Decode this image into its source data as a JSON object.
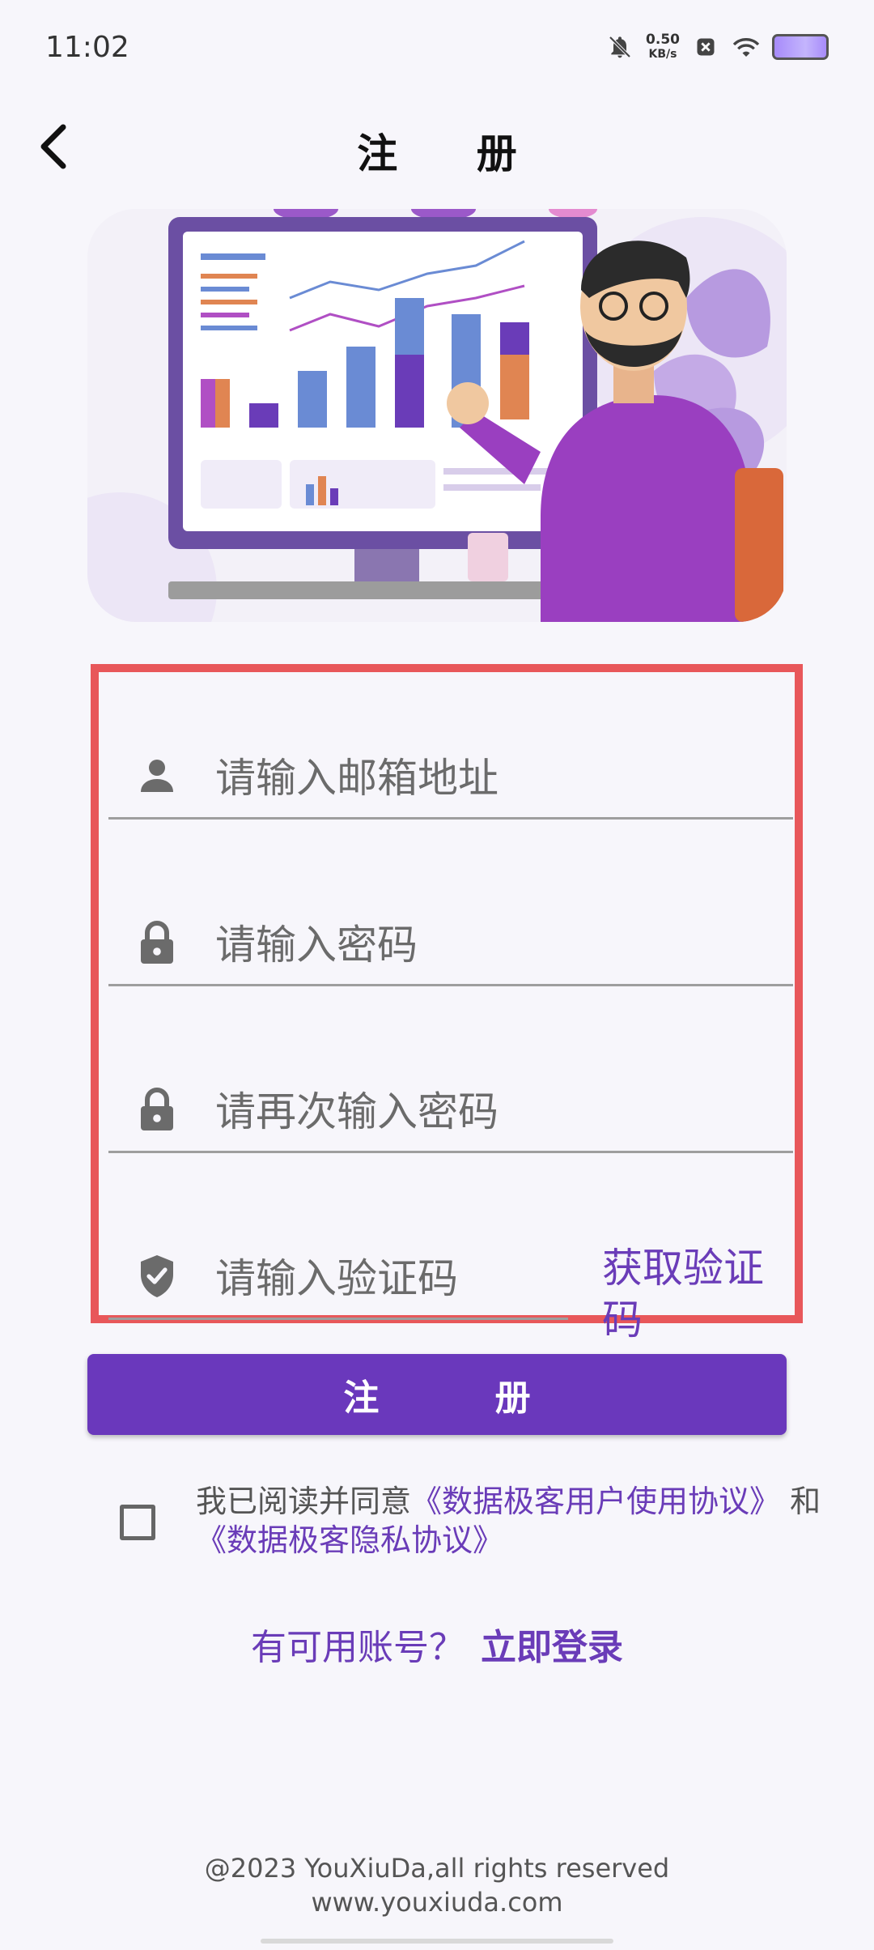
{
  "status_bar": {
    "time": "11:02",
    "net_speed_value": "0.50",
    "net_speed_unit": "KB/s",
    "icons": [
      "bell-off-icon",
      "sim-x-icon",
      "wifi-icon",
      "battery-icon"
    ]
  },
  "header": {
    "back_icon": "chevron-left-icon",
    "title": "注 册"
  },
  "form": {
    "email": {
      "placeholder": "请输入邮箱地址",
      "icon": "person-icon"
    },
    "password": {
      "placeholder": "请输入密码",
      "icon": "lock-icon"
    },
    "password_confirm": {
      "placeholder": "请再次输入密码",
      "icon": "lock-icon"
    },
    "code": {
      "placeholder": "请输入验证码",
      "icon": "shield-check-icon"
    },
    "get_code_label": "获取验证码"
  },
  "register_button": "注 册",
  "agreement": {
    "prefix": "我已阅读并同意",
    "user_agreement": "《数据极客用户使用协议》",
    "and": " 和 ",
    "privacy_policy": "《数据极客隐私协议》"
  },
  "login": {
    "prompt": "有可用账号？",
    "link": "立即登录"
  },
  "footer": {
    "copyright": "@2023 YouXiuDa,all rights reserved",
    "website": "www.youxiuda.com"
  },
  "colors": {
    "accent": "#6a38bc",
    "highlight_border": "#e8575a",
    "background": "#f7f6fb"
  }
}
